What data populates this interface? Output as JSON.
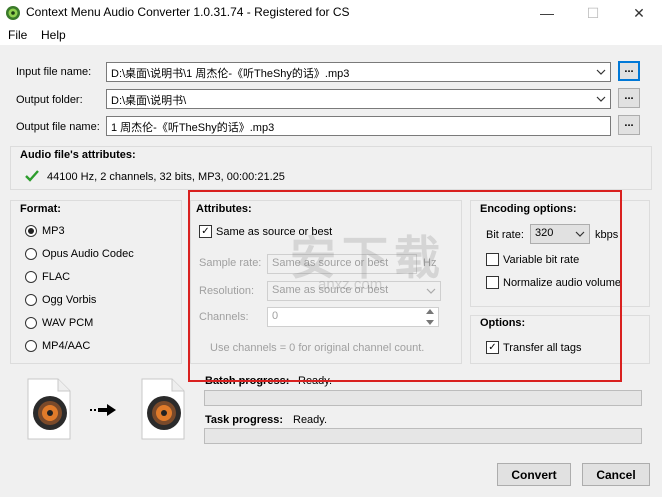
{
  "window": {
    "title": "Context Menu Audio Converter 1.0.31.74 - Registered for CS",
    "minimize_glyph": "—",
    "maximize_glyph": "☐",
    "close_glyph": "✕"
  },
  "menu": {
    "file": "File",
    "help": "Help"
  },
  "paths": {
    "input_label": "Input file name:",
    "input_value": "D:\\桌面\\说明书\\1 周杰伦-《听TheShy的话》.mp3",
    "output_folder_label": "Output folder:",
    "output_folder_value": "D:\\桌面\\说明书\\",
    "output_name_label": "Output file name:",
    "output_name_value": "1 周杰伦-《听TheShy的话》.mp3",
    "browse_label": "..."
  },
  "audio_attributes": {
    "heading": "Audio file's attributes:",
    "value": "44100 Hz, 2 channels, 32 bits, MP3, 00:00:21.25"
  },
  "format": {
    "heading": "Format:",
    "options": [
      "MP3",
      "Opus Audio Codec",
      "FLAC",
      "Ogg Vorbis",
      "WAV PCM",
      "MP4/AAC"
    ],
    "selected": "MP3"
  },
  "attributes": {
    "heading": "Attributes:",
    "same_as_source_label": "Same as source or best",
    "sample_rate_label": "Sample rate:",
    "sample_rate_value": "Same as source or best",
    "sample_rate_unit": "Hz",
    "resolution_label": "Resolution:",
    "resolution_value": "Same as source or best",
    "channels_label": "Channels:",
    "channels_value": "0",
    "channels_hint": "Use channels = 0 for original channel count."
  },
  "encoding": {
    "heading": "Encoding options:",
    "bitrate_label": "Bit rate:",
    "bitrate_value": "320",
    "bitrate_unit": "kbps",
    "vbr_label": "Variable bit rate",
    "normalize_label": "Normalize audio volume"
  },
  "options": {
    "heading": "Options:",
    "transfer_tags_label": "Transfer all tags"
  },
  "progress": {
    "batch_label": "Batch progress:",
    "batch_status": "Ready.",
    "task_label": "Task progress:",
    "task_status": "Ready.",
    "batch_fraction": 0,
    "task_fraction": 0
  },
  "buttons": {
    "convert": "Convert",
    "cancel": "Cancel"
  },
  "watermark": {
    "text": "安下载",
    "url": "anxz.com"
  },
  "colors": {
    "highlight_box": "#d9201f",
    "check_green": "#2d9d2d",
    "focus_blue": "#0078d7"
  }
}
